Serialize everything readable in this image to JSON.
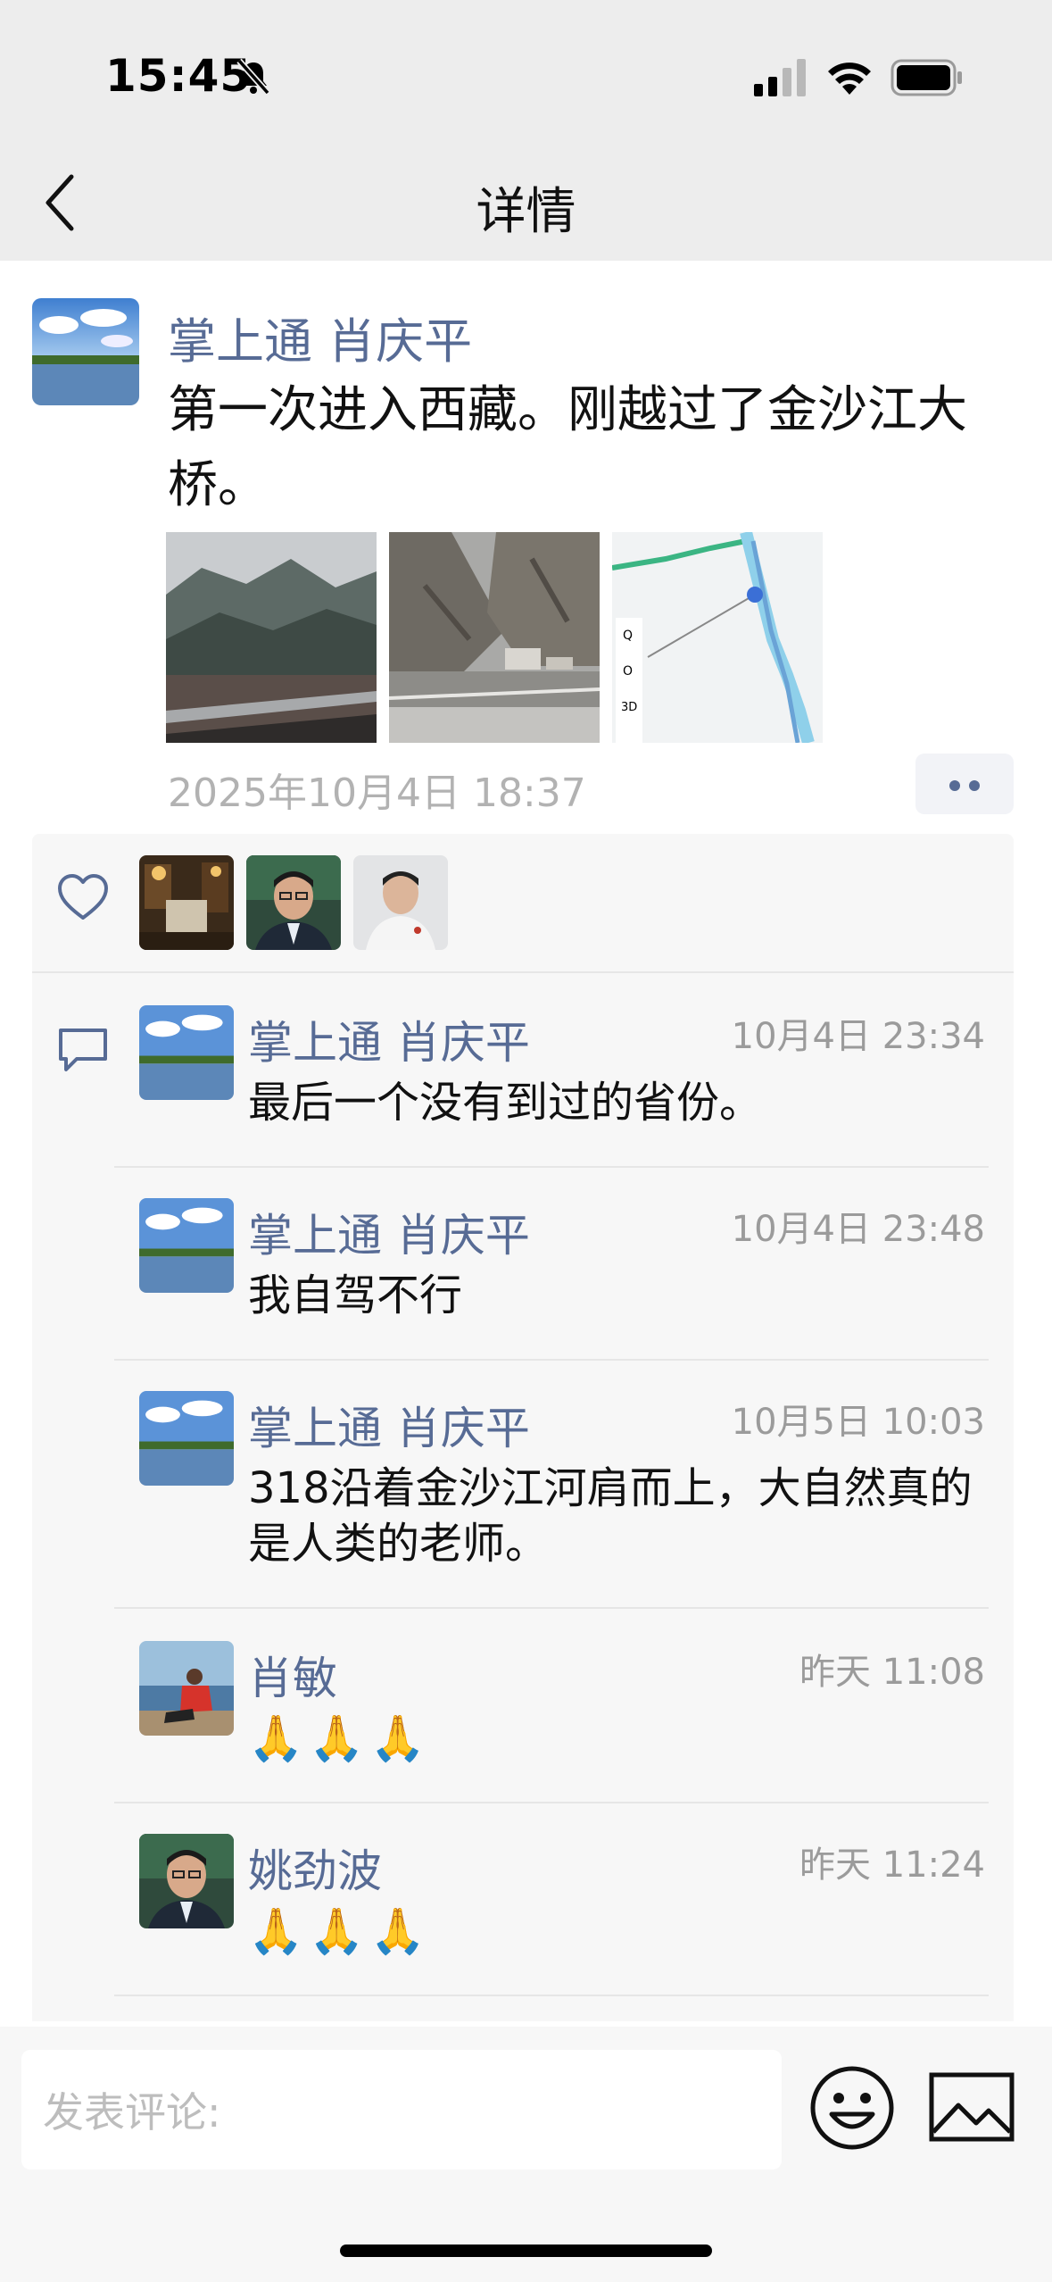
{
  "status_bar": {
    "time": "15:45"
  },
  "nav": {
    "title": "详情"
  },
  "post": {
    "author": "掌上通 肖庆平",
    "text": "第一次进入西藏。刚越过了金沙江大桥。",
    "timestamp": "2025年10月4日 18:37",
    "photos": [
      "valley-photo",
      "mountain-road-photo",
      "map-screenshot"
    ]
  },
  "likes": {
    "icon": "heart-outline-icon",
    "users": [
      "liker-avatar-1",
      "liker-avatar-2",
      "liker-avatar-3"
    ]
  },
  "comments": [
    {
      "name": "掌上通 肖庆平",
      "time": "10月4日 23:34",
      "text": "最后一个没有到过的省份。"
    },
    {
      "name": "掌上通 肖庆平",
      "time": "10月4日 23:48",
      "text": "我自驾不行"
    },
    {
      "name": "掌上通 肖庆平",
      "time": "10月5日 10:03",
      "text": "318沿着金沙江河肩而上，大自然真的是人类的老师。"
    },
    {
      "name": "肖敏",
      "time": "昨天 11:08",
      "text": "🙏🙏🙏"
    },
    {
      "name": "姚劲波",
      "time": "昨天 11:24",
      "text": "🙏🙏🙏"
    }
  ],
  "composer": {
    "placeholder": "发表评论:"
  },
  "colors": {
    "name": "#576b95",
    "background": "#ededed",
    "panel": "#f7f7f7",
    "muted": "#9b9b9b"
  }
}
